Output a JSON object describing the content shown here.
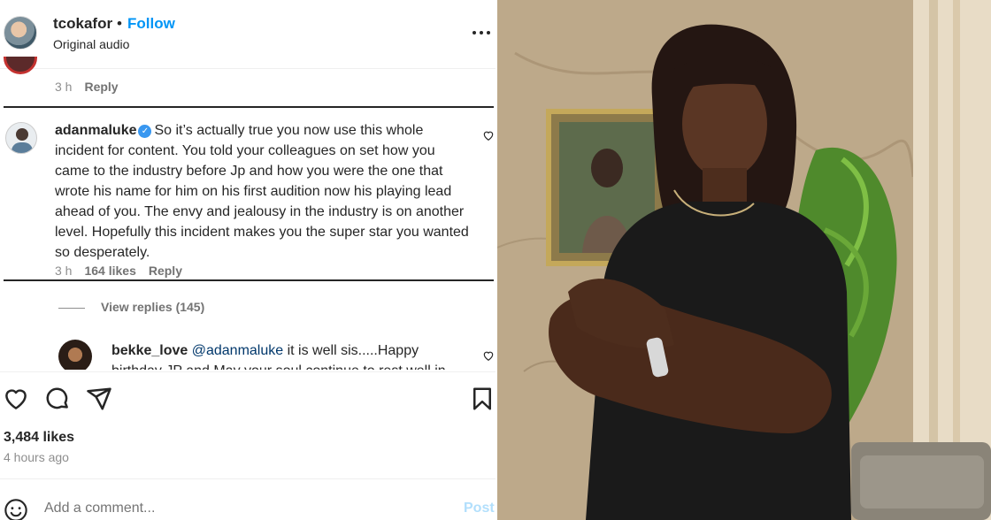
{
  "post": {
    "username": "tcokafor",
    "separator": "•",
    "follow_label": "Follow",
    "audio_label": "Original audio"
  },
  "previous_comment": {
    "time": "3 h",
    "reply_label": "Reply"
  },
  "comment": {
    "username": "adanmaluke",
    "text": "So it’s actually true you now use this whole incident for content. You told your colleagues on set how you came to the industry before Jp and how you were the one that wrote his name for him on his first audition now his playing lead ahead of you. The envy and jealousy in the industry is on another level. Hopefully this incident makes you the super star you wanted so desperately.",
    "time": "3 h",
    "likes": "164 likes",
    "reply_label": "Reply",
    "view_replies": "View replies (145)"
  },
  "reply": {
    "username": "bekke_love",
    "mention": "@adanmaluke",
    "text": "it is well sis.....Happy birthday JP and May your soul continue to rest well in"
  },
  "stats": {
    "likes": "3,484 likes",
    "time_ago": "4 hours ago"
  },
  "composer": {
    "placeholder": "Add a comment...",
    "post_label": "Post"
  },
  "colors": {
    "accent": "#0095f6",
    "verified": "#3897f0",
    "post_disabled": "#b2dffc"
  }
}
